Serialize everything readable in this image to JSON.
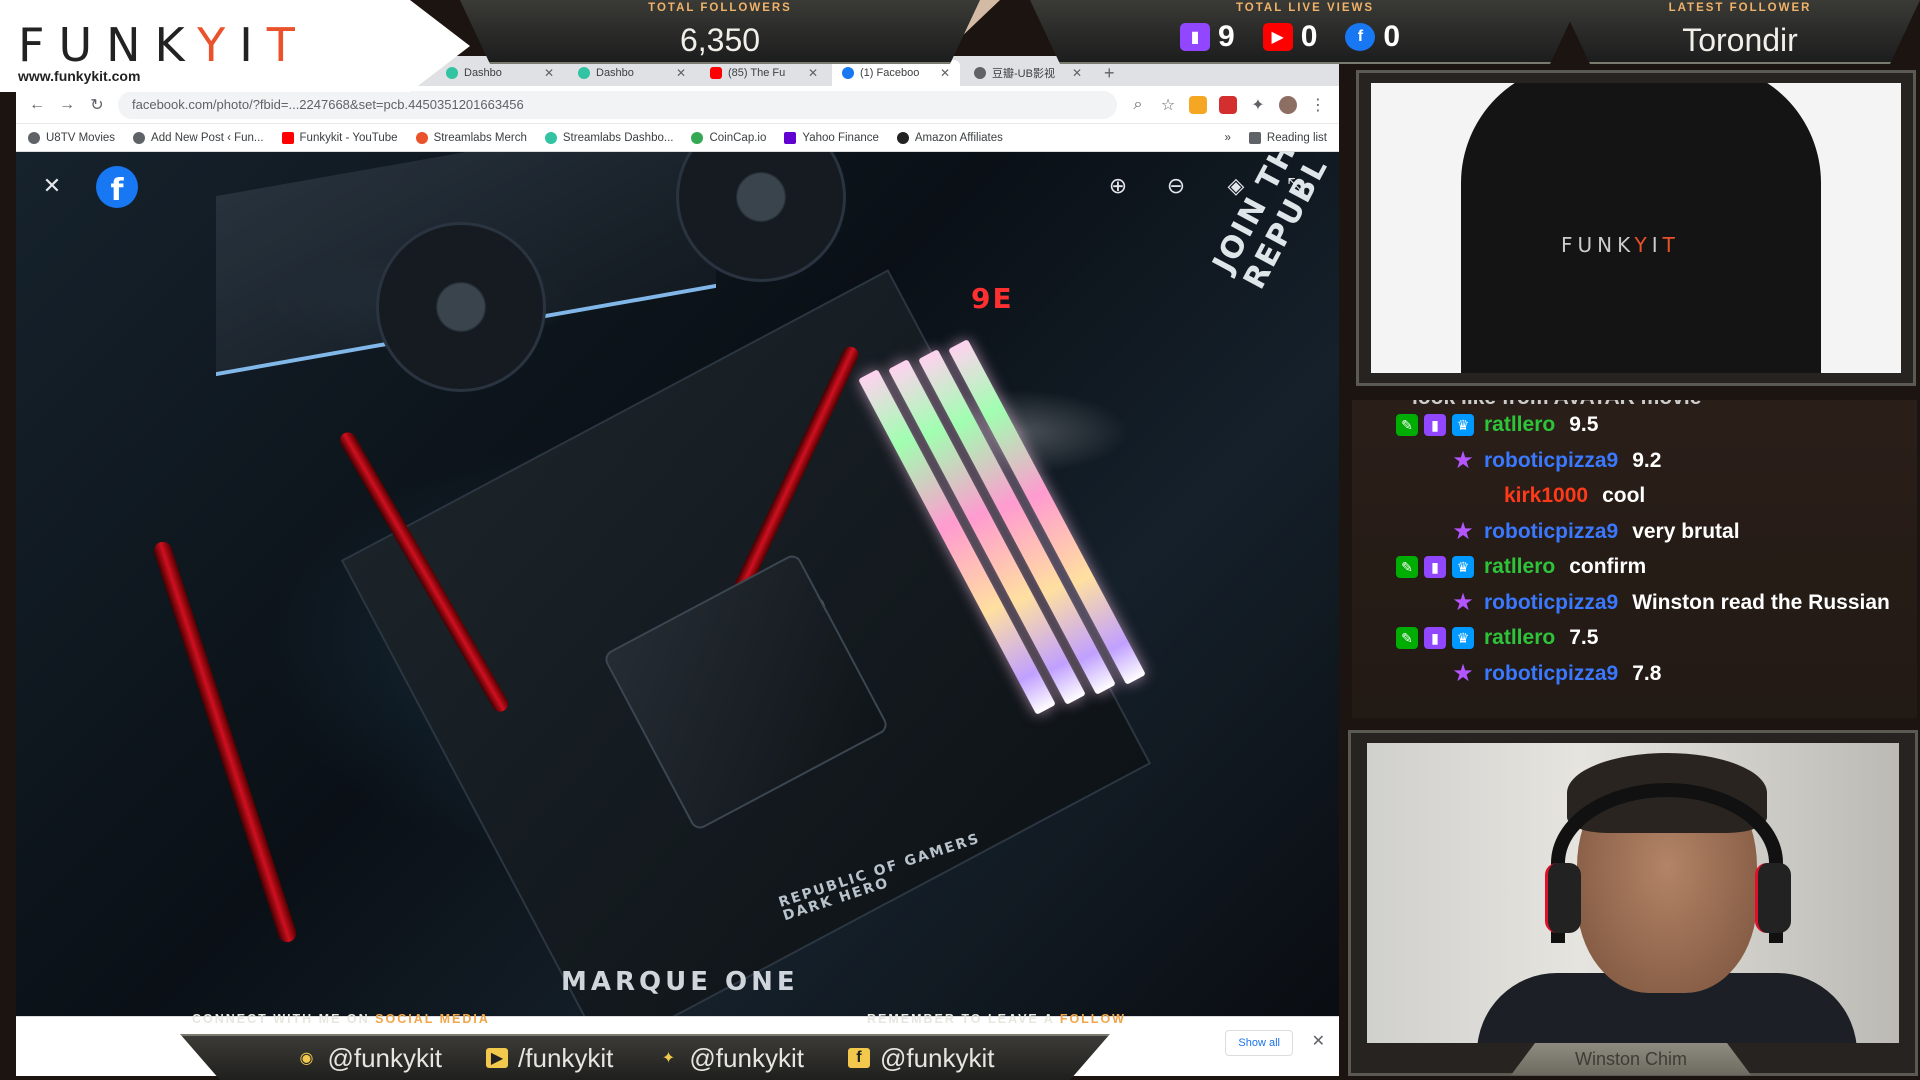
{
  "overlay": {
    "brand_url": "www.funkykit.com",
    "total_followers_caption": "TOTAL FOLLOWERS",
    "total_followers_value": "6,350",
    "total_live_views_caption": "TOTAL LIVE VIEWS",
    "views": {
      "twitch": "9",
      "youtube": "0",
      "facebook": "0"
    },
    "latest_follower_caption": "LATEST FOLLOWER",
    "latest_follower_name": "Torondir",
    "connect_prefix": "CONNECT WITH ME ON",
    "connect_highlight": "SOCIAL MEDIA",
    "remember_prefix": "REMEMBER TO LEAVE A",
    "remember_highlight": "FOLLOW",
    "socials": [
      {
        "icon": "streamlabs-icon",
        "handle": "@funkykit"
      },
      {
        "icon": "youtube-icon",
        "handle": "/funkykit"
      },
      {
        "icon": "twitter-icon",
        "handle": "@funkykit"
      },
      {
        "icon": "facebook-icon",
        "handle": "@funkykit"
      }
    ],
    "webcam_name": "Winston Chim"
  },
  "browser": {
    "tabs": [
      {
        "label": "Dashbo",
        "active": false
      },
      {
        "label": "Dashbo",
        "active": false
      },
      {
        "label": "(85) The Fu",
        "active": false
      },
      {
        "label": "(1) Faceboo",
        "active": true
      },
      {
        "label": "豆瓣-UB影视",
        "active": false
      }
    ],
    "url": "facebook.com/photo/?fbid=...2247668&set=pcb.4450351201663456",
    "bookmarks": [
      "U8TV Movies",
      "Add New Post ‹ Fun...",
      "Funkykit - YouTube",
      "Streamlabs Merch",
      "Streamlabs Dashbo...",
      "CoinCap.io",
      "Yahoo Finance",
      "Amazon Affiliates"
    ],
    "more_bookmarks": "»",
    "reading_list": "Reading list",
    "show_all": "Show all",
    "photo_text_ram": "9E",
    "photo_text_rog": "JOIN THE REPUBL",
    "photo_text_brand": "MARQUE ONE",
    "photo_text_board": "REPUBLIC OF GAMERS DARK HERO"
  },
  "chat": {
    "cut_line": "look like from AVATAR movie",
    "messages": [
      {
        "user": "ratllero",
        "color": "#2ec43a",
        "badges": [
          "sword",
          "sub",
          "prime"
        ],
        "text": "9.5"
      },
      {
        "user": "roboticpizza9",
        "color": "#3a79ff",
        "badges": [
          "star"
        ],
        "text": "9.2"
      },
      {
        "user": "kirk1000",
        "color": "#ff3a1a",
        "badges": [],
        "text": "cool"
      },
      {
        "user": "roboticpizza9",
        "color": "#3a79ff",
        "badges": [
          "star"
        ],
        "text": "very brutal"
      },
      {
        "user": "ratllero",
        "color": "#2ec43a",
        "badges": [
          "sword",
          "sub",
          "prime"
        ],
        "text": "confirm"
      },
      {
        "user": "roboticpizza9",
        "color": "#3a79ff",
        "badges": [
          "star"
        ],
        "text": "Winston read the Russian"
      },
      {
        "user": "ratllero",
        "color": "#2ec43a",
        "badges": [
          "sword",
          "sub",
          "prime"
        ],
        "text": "7.5"
      },
      {
        "user": "roboticpizza9",
        "color": "#3a79ff",
        "badges": [
          "star"
        ],
        "text": "7.8"
      }
    ]
  },
  "merch": {
    "logo": "FUNKYIT"
  },
  "colors": {
    "accent_orange": "#f2a54a",
    "brand_orange": "#e9522a",
    "facebook_blue": "#1877f2"
  }
}
